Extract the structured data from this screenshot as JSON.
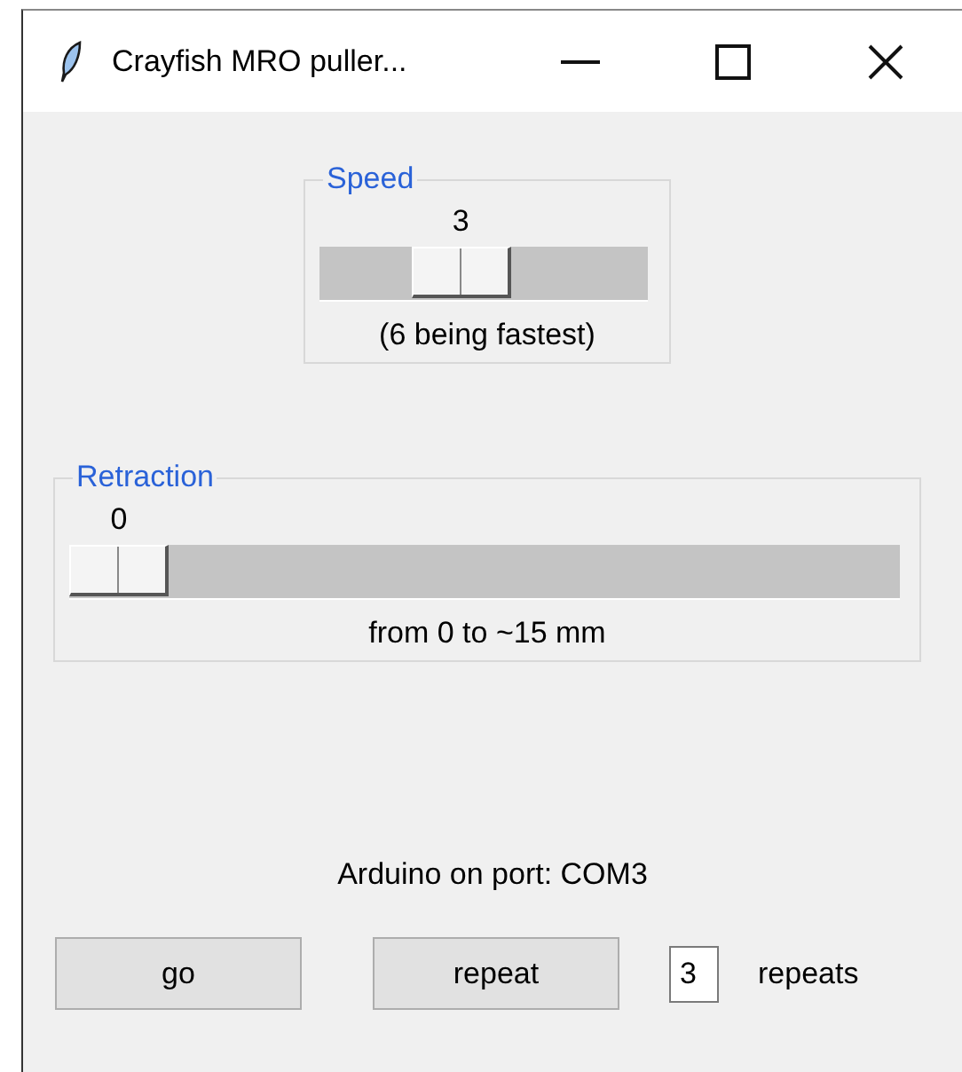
{
  "window": {
    "title": "Crayfish MRO puller..."
  },
  "speed": {
    "title": "Speed",
    "value": "3",
    "level": 0.4,
    "caption": "(6 being fastest)"
  },
  "retraction": {
    "title": "Retraction",
    "value": "0",
    "level": 0,
    "caption": "from 0 to ~15 mm"
  },
  "status": "Arduino on port: COM3",
  "buttons": [
    {
      "label": "go"
    },
    {
      "label": "repeat"
    }
  ],
  "repeats": {
    "value": "3",
    "label": "repeats"
  }
}
